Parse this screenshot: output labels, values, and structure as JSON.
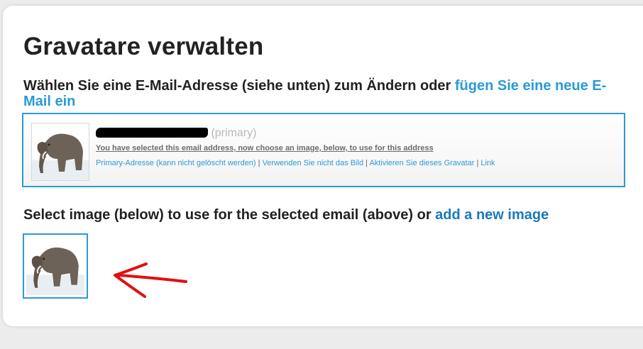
{
  "page": {
    "title": "Gravatare verwalten",
    "subtitle_text": "Wählen Sie eine E-Mail-Adresse (siehe unten) zum Ändern oder ",
    "subtitle_link": "fügen Sie eine neue E-Mail ein"
  },
  "email_entry": {
    "address_redacted": true,
    "primary_label": "(primary)",
    "selected_note": "You have selected this email address, now choose an image, below, to use for this address",
    "actions": [
      "Primary-Adresse (kann nicht gelöscht werden)",
      "Verwenden Sie nicht das Bild",
      "Aktivieren Sie dieses Gravatar",
      "Link"
    ],
    "separator": "|",
    "thumbnail_icon": "elephant-image"
  },
  "image_select": {
    "text": "Select image (below) to use for the selected email (above) or ",
    "link": "add a new image",
    "images": [
      {
        "icon": "elephant-image",
        "selected": true
      }
    ]
  },
  "annotation": {
    "icon": "red-arrow",
    "color": "#e01010"
  },
  "colors": {
    "accent": "#2a9ad8",
    "link_dark": "#1a79b8",
    "text": "#222222"
  }
}
